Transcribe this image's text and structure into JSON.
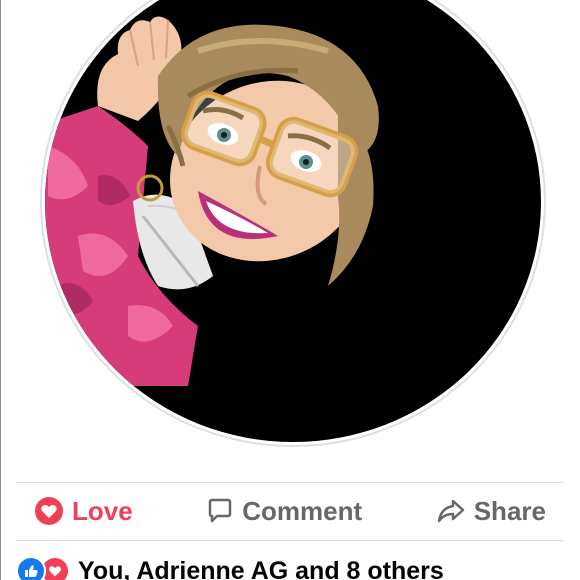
{
  "colors": {
    "love": "#f33e58",
    "like": "#1877f2",
    "action_gray": "#65676b",
    "text_dark": "#050505"
  },
  "actions": {
    "love_label": "Love",
    "comment_label": "Comment",
    "share_label": "Share"
  },
  "reactions": {
    "icons": [
      "like-icon",
      "heart-icon"
    ],
    "summary": "You, Adrienne AG and 8 others"
  },
  "avatar": {
    "description_icon": "profile-avatar"
  }
}
